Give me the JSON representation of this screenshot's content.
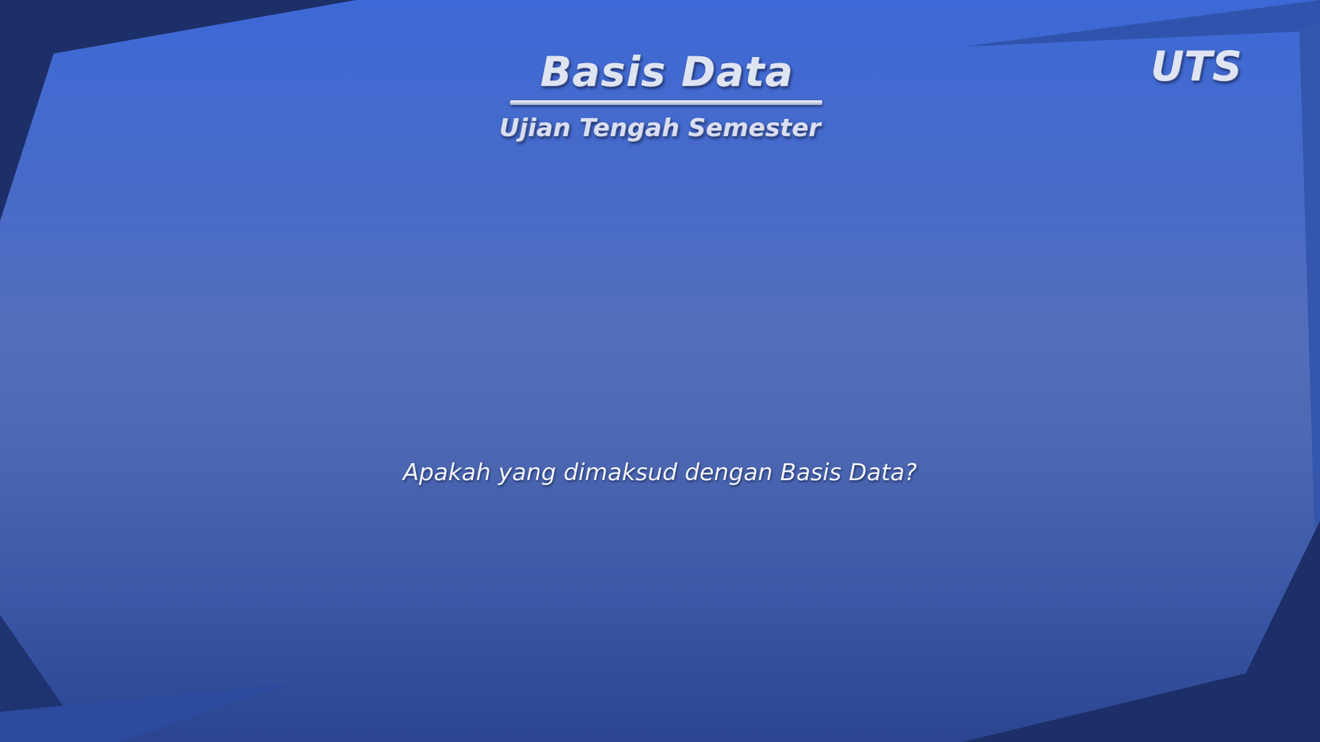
{
  "slide": {
    "title": "Basis Data",
    "subtitle": "Ujian Tengah Semester",
    "badge": "UTS",
    "question": "Apakah yang dimaksud dengan Basis Data?"
  },
  "colors": {
    "background_dark": "#1d2f68",
    "panel_top": "#3d69d6",
    "panel_middle": "#536fb9",
    "panel_bottom": "#2b4590",
    "text_light": "#dfe4f2"
  }
}
